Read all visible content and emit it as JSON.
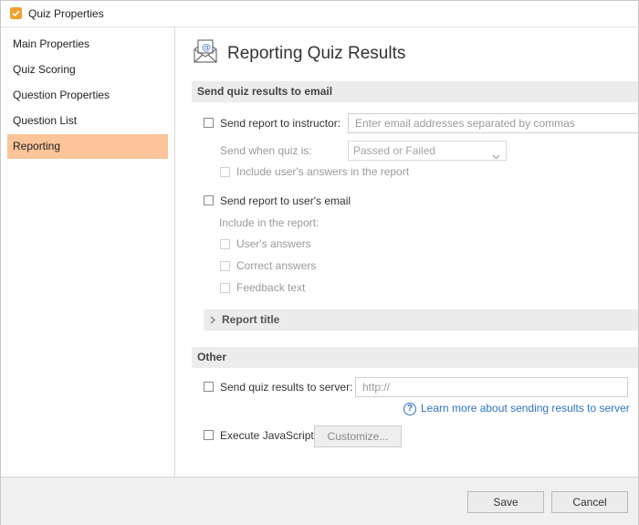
{
  "window": {
    "title": "Quiz Properties",
    "accent": "#f0a030"
  },
  "sidebar": {
    "items": [
      {
        "label": "Main Properties"
      },
      {
        "label": "Quiz Scoring"
      },
      {
        "label": "Question Properties"
      },
      {
        "label": "Question List"
      },
      {
        "label": "Reporting",
        "active": true
      }
    ],
    "active_color": "#fbc49a"
  },
  "page": {
    "title": "Reporting Quiz Results",
    "sections": {
      "email": {
        "title": "Send quiz results to email",
        "instructor": {
          "label": "Send report to instructor:",
          "checked": false,
          "email_placeholder": "Enter email addresses separated by commas",
          "send_when_label": "Send when quiz is:",
          "send_when_value": "Passed or Failed",
          "include_answers_label": "Include user's answers in the report"
        },
        "user": {
          "label": "Send report to user's email",
          "checked": false,
          "include_label": "Include in the report:",
          "options": [
            "User's answers",
            "Correct answers",
            "Feedback text"
          ]
        },
        "report_title": {
          "label": "Report title",
          "expanded": false
        }
      },
      "other": {
        "title": "Other",
        "server": {
          "label": "Send quiz results to server:",
          "checked": false,
          "url_placeholder": "http://",
          "help_link": "Learn more about sending results to server"
        },
        "javascript": {
          "label": "Execute JavaScript",
          "checked": false,
          "customize_label": "Customize..."
        }
      }
    }
  },
  "footer": {
    "save_label": "Save",
    "cancel_label": "Cancel"
  },
  "icons": {
    "app": "checkbox-icon",
    "header": "email-envelope-icon",
    "help": "help-circle-icon",
    "chevron_right": "chevron-right-icon",
    "chevron_down": "chevron-down-icon"
  },
  "link_color": "#2f73c4"
}
